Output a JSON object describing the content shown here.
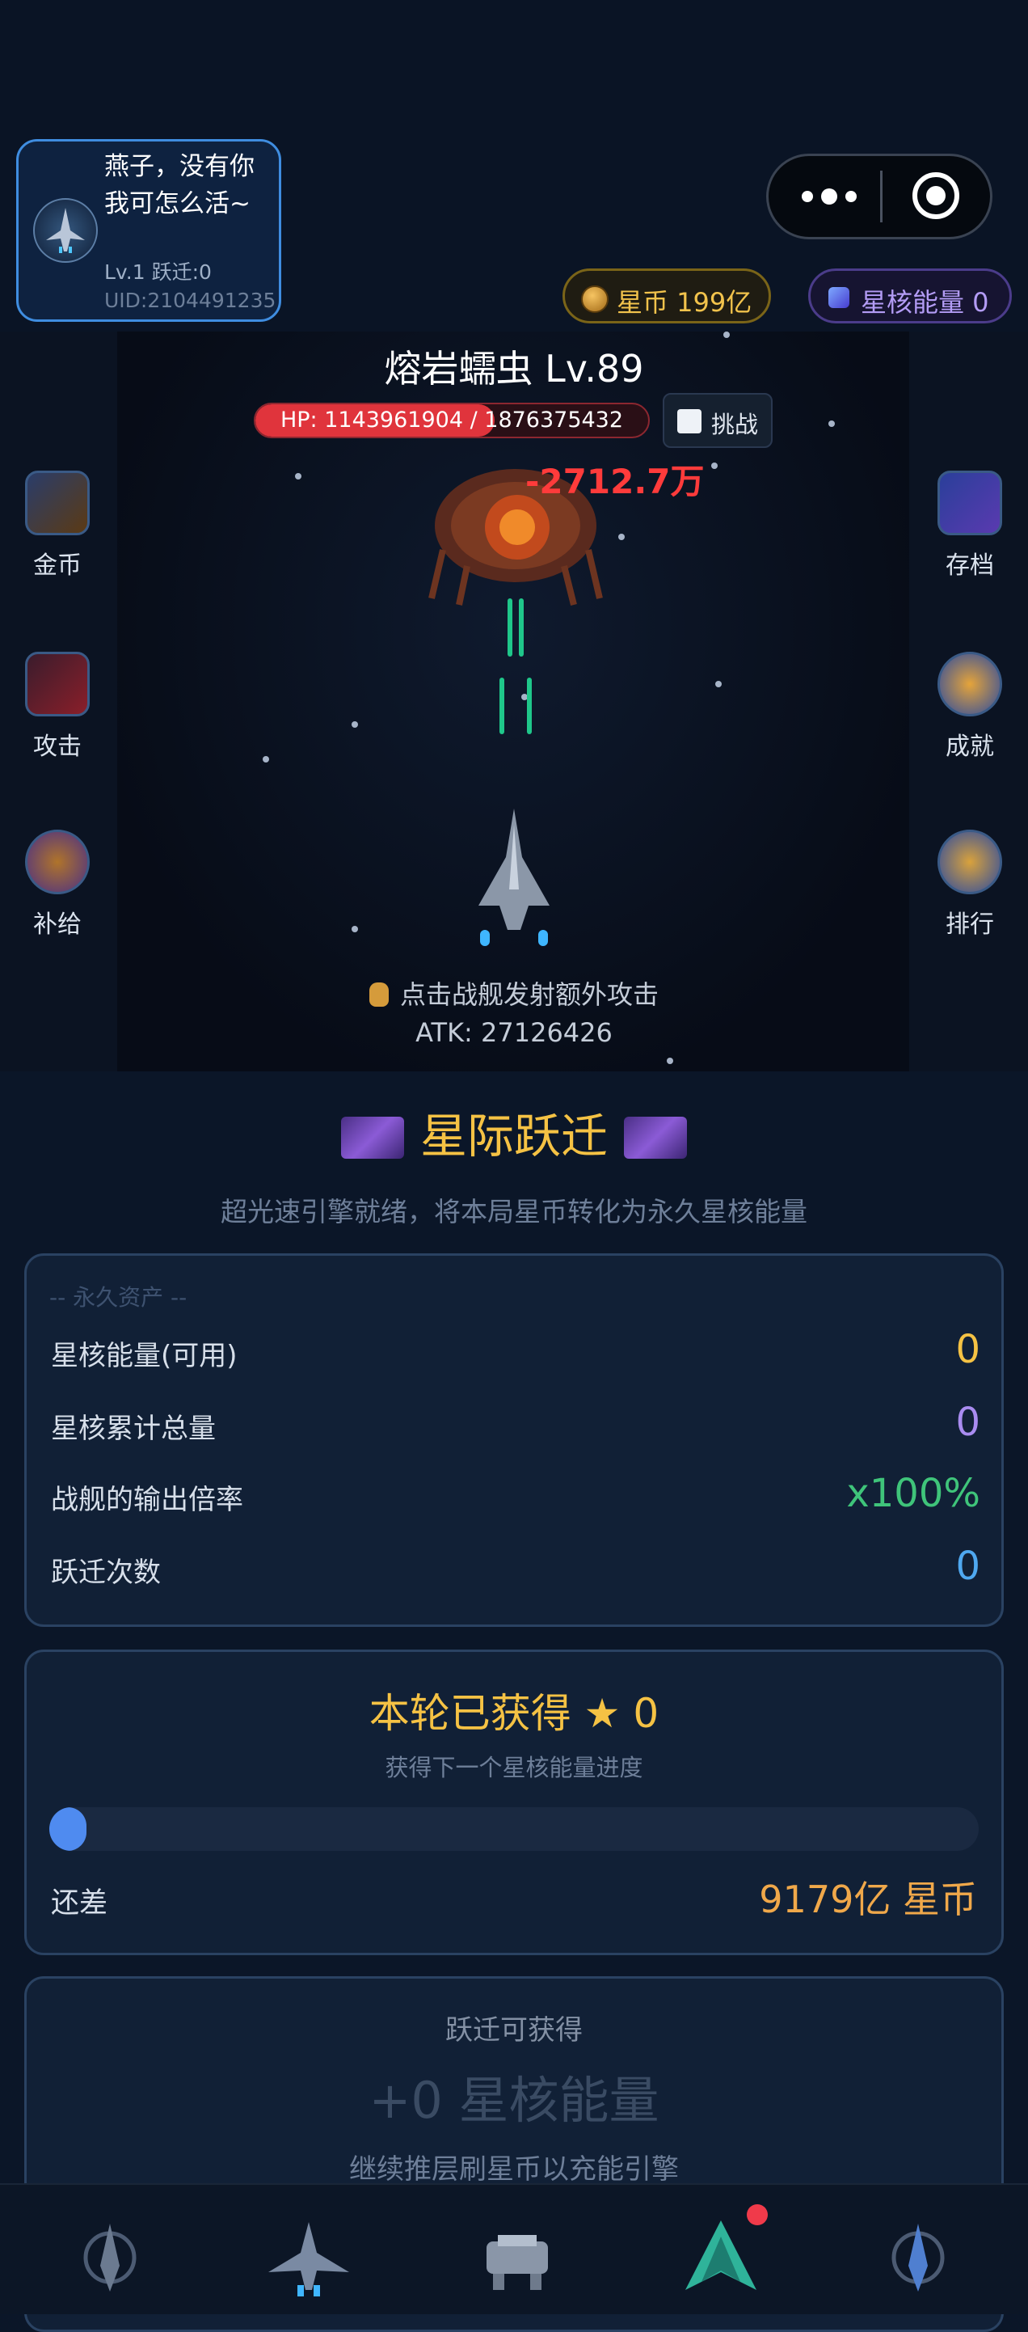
{
  "profile": {
    "nickname": "燕子，没有你我可怎么活~",
    "level_line": "Lv.1 跃迁:0",
    "uid_line": "UID:2104491235"
  },
  "currency": {
    "coin_label": "星币 199亿",
    "energy_label": "星核能量 0",
    "coin_color": "#f2c34c",
    "energy_color": "#b39cf5"
  },
  "battle": {
    "boss_name": "熔岩蠕虫 Lv.89",
    "hp_text": "HP: 1143961904 / 1876375432",
    "hp_fraction": 0.61,
    "challenge_label": "挑战",
    "damage_text": "-2712.7万",
    "tip": "点击战舰发射额外攻击",
    "atk": "ATK: 27126426"
  },
  "side_left": [
    {
      "label": "金币",
      "icon": "gold-coin-icon"
    },
    {
      "label": "攻击",
      "icon": "crossed-swords-icon"
    },
    {
      "label": "补给",
      "icon": "supply-crate-icon"
    }
  ],
  "side_right": [
    {
      "label": "存档",
      "icon": "save-device-icon"
    },
    {
      "label": "成就",
      "icon": "trophy-icon"
    },
    {
      "label": "排行",
      "icon": "podium-icon"
    }
  ],
  "warp": {
    "title": "星际跃迁",
    "subtitle": "超光速引擎就绪，将本局星币转化为永久星核能量"
  },
  "assets": {
    "header": "-- 永久资产 --",
    "rows": [
      {
        "label": "星核能量(可用)",
        "value": "0",
        "color": "#f5c244"
      },
      {
        "label": "星核累计总量",
        "value": "0",
        "color": "#a98cf0"
      },
      {
        "label": "战舰的输出倍率",
        "value": "x100%",
        "color": "#3fc47a"
      },
      {
        "label": "跃迁次数",
        "value": "0",
        "color": "#4fa8f0"
      }
    ]
  },
  "round": {
    "title": "本轮已获得 ★ 0",
    "subtitle": "获得下一个星核能量进度",
    "progress_fraction": 0.04,
    "remain_label": "还差",
    "remain_value": "9179亿 星币"
  },
  "gain": {
    "header": "跃迁可获得",
    "value": "+0 星核能量",
    "note": "继续推层刷星币以充能引擎"
  },
  "tabbar": {
    "tabs": [
      "emblem-icon",
      "fighter-ship-icon",
      "mech-icon",
      "arrow-ship-icon",
      "blue-emblem-icon"
    ],
    "badge_color": "#f03a4a"
  }
}
